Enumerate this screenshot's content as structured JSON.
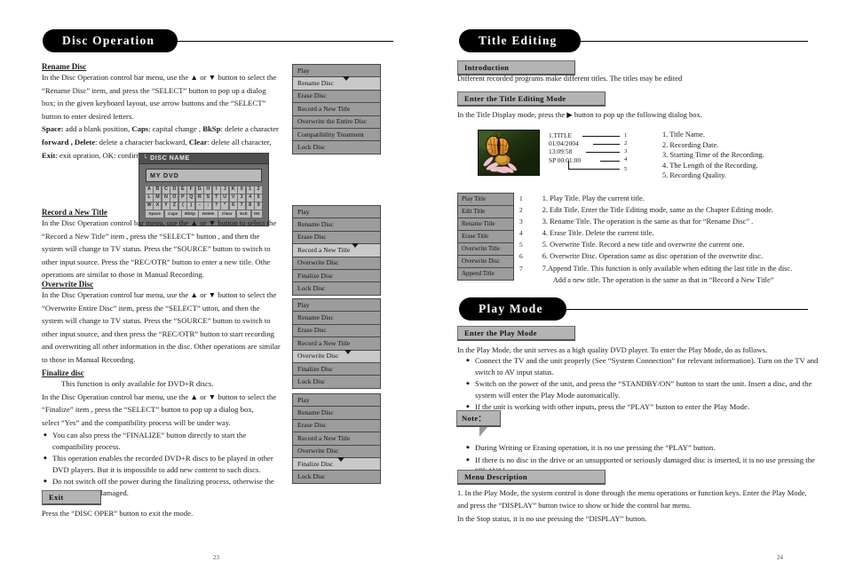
{
  "left_page": {
    "banner": "Disc Operation",
    "page_number": "23",
    "sections": [
      {
        "heading": "Rename Disc",
        "paragraphs": [
          "In the Disc Operation control bar menu, use the ▲ or ▼ button to select the",
          "“Rename Disc” item, and press the “SELECT” button to pop up a dialog",
          "box;  in the given keyboard layout,  use arrow buttons and the “SELECT”",
          "button to enter desired letters."
        ],
        "key_lines": [
          {
            "bold": "Space:",
            "rest": " add a blank position, ",
            "bold2": "Caps",
            "rest2": ": capital change , ",
            "bold3": "BkSp",
            "rest3": ": delete a character"
          },
          {
            "bold": "forward , ",
            "rest": "",
            "bold2": "Delete",
            "rest2": ": delete a character backward, ",
            "bold3": "Clear",
            "rest3": ": delete all character,"
          },
          {
            "bold": "Exit",
            "rest": ": exit opration, OK: confirm operation.",
            "bold2": "",
            "rest2": "",
            "bold3": "",
            "rest3": ""
          }
        ]
      },
      {
        "heading": "Record a New Title",
        "paragraphs": [
          "In the Disc Operation control bar menu, use the ▲ or ▼ button to select the",
          "“Record a New Title” item , press the “SELECT” button , and then the",
          "system will change to TV status. Press the “SOURCE” button to switch to",
          "other input source. Press the “REC/OTR” button to enter a new title. Othe",
          "operations are similar to those in Manual Recording."
        ]
      },
      {
        "heading": "Overwrite Disc",
        "paragraphs": [
          "In the Disc Operation control bar menu, use the ▲ or ▼ button to select the",
          "“Overwrite Entire Disc” item, press the “SELECT” utton, and then the",
          "system will change to TV status. Press the “SOURCE” button to switch to",
          "other input source, and then press the “REC/OTR” button to start recording",
          "and overwriting all other information in the disc. Other operations are similar",
          "to those in Manual Recording."
        ]
      },
      {
        "heading": "Finalize disc",
        "paragraphs": [
          "This function is only available for DVD+R discs.",
          "In the Disc Operation control bar menu, use the ▲ or ▼ button to select the",
          "“Finalize” item , press the “SELECT” button to pop up a dialog box,",
          "select “Yes” and the compatibility process will be under way."
        ],
        "bullets": [
          "You can also press the “FINALIZE” button directly to start the compatibility process.",
          "This operation enables the recorded DVD+R discs to be played in other DVD players. But it is impossible to add new content to such discs.",
          "Do not switch off the power during the finalizing process, otherwise the discs might be damaged."
        ]
      }
    ],
    "exit_chip": "Exit",
    "exit_text": "Press the “DISC OPER” button to exit the mode.",
    "osd_dialog": {
      "title": "└ DISC NAME",
      "field_value": "MY DVD",
      "keyboard_rows": [
        [
          "A",
          "B",
          "C",
          "D",
          "E",
          "F",
          "G",
          "H",
          "I",
          "J",
          "K",
          "0",
          "1",
          "2"
        ],
        [
          "L",
          "M",
          "N",
          "O",
          "P",
          "Q",
          "R",
          "S",
          "T",
          "U",
          "V",
          "3",
          "4",
          "5"
        ],
        [
          "W",
          "X",
          "Y",
          "Z",
          "(",
          ")",
          "-",
          ":",
          "?",
          "*",
          "6",
          "7",
          "8",
          "9"
        ]
      ],
      "function_keys": [
        "Space",
        "Caps",
        "BkSp",
        "Delete",
        "Clear",
        "Exit",
        "OK"
      ]
    },
    "menus": [
      {
        "name": "rename-disc-menu",
        "items": [
          "Play",
          "Rename Disc",
          "Erase Disc",
          "Record a New Title",
          "Overwrite the Entire Disc",
          "Compatibility Treatment",
          "Lock Disc"
        ],
        "selected_index": 1
      },
      {
        "name": "record-new-title-menu",
        "items": [
          "Play",
          "Rename Disc",
          "Erase Disc",
          "Record a New Title",
          "Overwrite  Disc",
          "Finalize Disc",
          "Lock Disc"
        ],
        "selected_index": 3
      },
      {
        "name": "overwrite-disc-menu",
        "items": [
          "Play",
          "Rename Disc",
          "Erase Disc",
          "Record a New Title",
          "Overwrite Disc",
          "Finalize Disc",
          "Lock Disc"
        ],
        "selected_index": 4
      },
      {
        "name": "finalize-disc-menu",
        "items": [
          "Play",
          "Rename Disc",
          "Erase Disc",
          "Record a New Title",
          "Overwrite Disc",
          "Finalize Disc",
          "Lock Disc"
        ],
        "selected_index": 5
      }
    ]
  },
  "right_page": {
    "page_number": "24",
    "title_editing": {
      "banner": "Title Editing",
      "intro_chip": "Introduction",
      "intro_text": "Different recorded programs make different titles. The titles may be edited",
      "enter_chip": "Enter the Title Editing Mode",
      "enter_text": "In the Title Display mode, press the ▶ button to pop up the following dialog box.",
      "osd_info": {
        "lines": [
          "1.TITLE",
          "01/04/2004",
          "13:09:58",
          "SP  00:01:00"
        ],
        "markers": [
          "1",
          "2",
          "3",
          "4",
          "5"
        ]
      },
      "legend": [
        "1. Title Name.",
        "2. Recording Date.",
        "3. Starting Time of the Recording.",
        "4. The Length of the Recording.",
        "5. Recording Quality."
      ],
      "menu_items": [
        "Play Title",
        "Edit Title",
        "Rename Title",
        "Erase Title",
        "Overwrite Title",
        "Overwrite Disc",
        "Append Title"
      ],
      "menu_numbers": [
        "1",
        "2",
        "3",
        "4",
        "5",
        "6",
        "7"
      ],
      "descriptions": [
        "1. Play Title. Play the current title.",
        "2. Edit Title. Enter the Title Editing mode, same as the Chapter Editing mode.",
        "3. Rename Title. The operation is the same as that for “Rename Disc” .",
        "4. Erase Title. Delete the current title.",
        "5. Overwrite Title. Record a new title and overwrite the current one.",
        "6. Overwrite Disc. Operation same as disc operation of the overwrite disc.",
        "7.Append Title. This function is only available when editing the last title in the disc."
      ],
      "description_cont": "Add a new title. The operation is the same as that in  “Record a New Title”"
    },
    "play_mode": {
      "banner": "Play Mode",
      "enter_chip": "Enter the Play Mode",
      "intro_text": "In the Play Mode, the unit serves as a high quality DVD player. To enter the Play Mode, do as follows.",
      "bullets": [
        "Connect the TV and the unit properly (See “System Connection” for relevant information).  Turn on the TV and switch to AV input status.",
        "Switch on the power of the unit, and press the “STANDBY/ON” button to start the unit. Insert a disc, and the system will enter the Play Mode automatically.",
        "If the unit is working with other inputs, press the “PLAY” button to enter the Play Mode."
      ],
      "note_chip": "Note：",
      "note_bullets": [
        "During Writing or Erasing operation, it is no use pressing the “PLAY” button.",
        "If there is no disc in the drive or an unsupported or seriously damaged disc is inserted, it is no use pressing the “PLAY” button."
      ],
      "menu_desc_chip": "Menu Description",
      "menu_desc_lines": [
        "1. In the Play Mode, the system control is done through the menu operations or function keys. Enter the Play Mode,",
        "and press the “DISPLAY” button twice to show or hide the control bar menu.",
        "In the Stop status, it is no use pressing the “DISPLAY” button."
      ]
    }
  },
  "colors": {
    "banner_bg": "#000000",
    "chip_bg": "#b4b4b4",
    "menu_bg": "#9c9c9c",
    "menu_selected": "#c9c9c9"
  }
}
